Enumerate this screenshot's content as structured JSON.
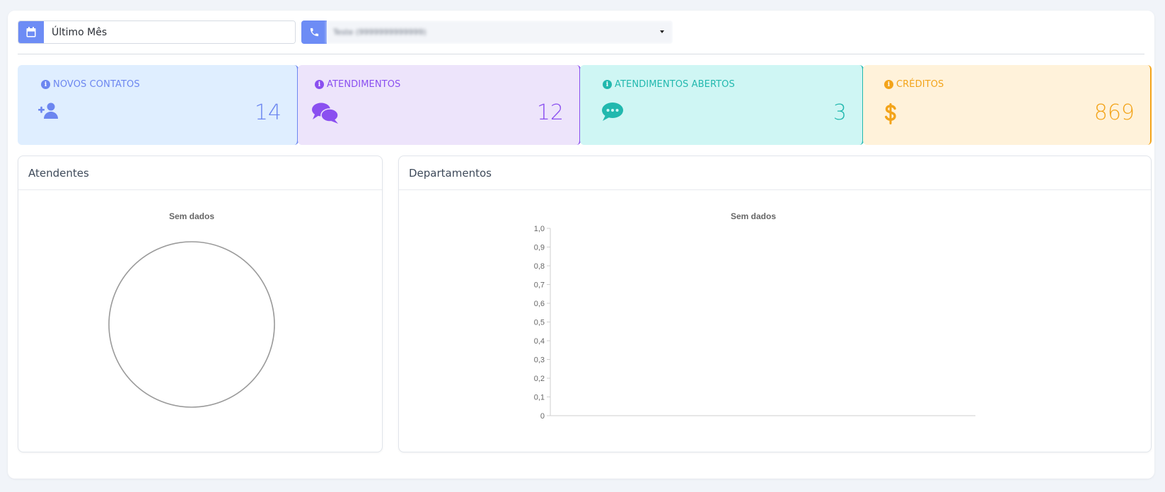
{
  "filters": {
    "date_range": "Último Mês",
    "connection": "Teste (9999999999999)"
  },
  "stats": [
    {
      "label": "NOVOS CONTATOS",
      "value": "14",
      "icon": "user-plus-icon",
      "color": "#6c86f0"
    },
    {
      "label": "ATENDIMENTOS",
      "value": "12",
      "icon": "comments-icon",
      "color": "#8a4ff0"
    },
    {
      "label": "ATENDIMENTOS ABERTOS",
      "value": "3",
      "icon": "comment-dots-icon",
      "color": "#21b8ae"
    },
    {
      "label": "CRÉDITOS",
      "value": "869",
      "icon": "dollar-icon",
      "color": "#f3a41a"
    }
  ],
  "panels": {
    "atendentes_title": "Atendentes",
    "departamentos_title": "Departamentos"
  },
  "chart_data": [
    {
      "type": "pie",
      "title": "Sem dados",
      "categories": [],
      "values": []
    },
    {
      "type": "bar",
      "title": "Sem dados",
      "categories": [],
      "series": [],
      "ylim": [
        0,
        1
      ],
      "yticks": [
        "0",
        "0,1",
        "0,2",
        "0,3",
        "0,4",
        "0,5",
        "0,6",
        "0,7",
        "0,8",
        "0,9",
        "1,0"
      ]
    }
  ]
}
